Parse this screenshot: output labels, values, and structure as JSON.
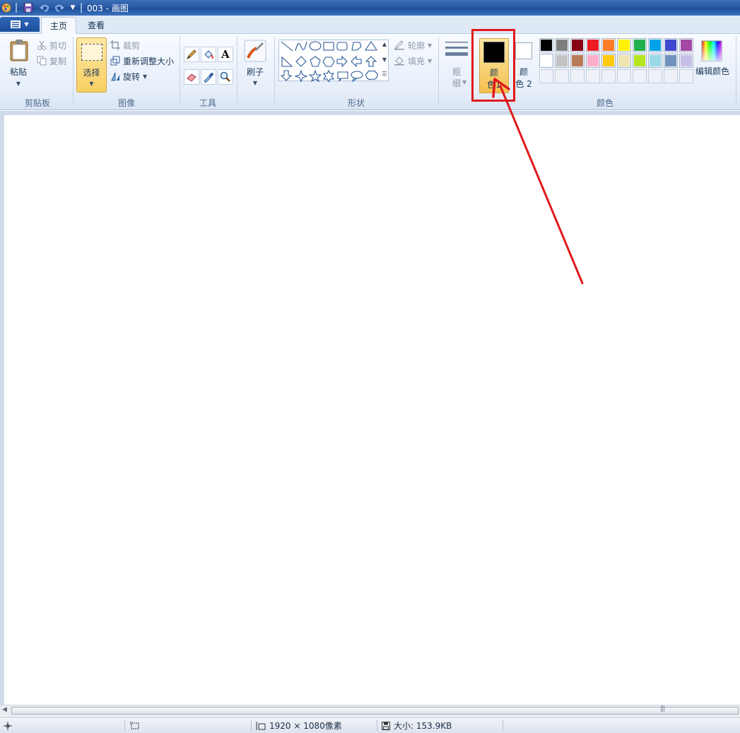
{
  "window": {
    "title": "003 - 画图"
  },
  "tabs": {
    "home": "主页",
    "view": "查看"
  },
  "clipboard": {
    "paste": "粘贴",
    "cut": "剪切",
    "copy": "复制",
    "group": "剪贴板"
  },
  "image": {
    "select": "选择",
    "crop": "裁剪",
    "resize": "重新调整大小",
    "rotate": "旋转",
    "group": "图像"
  },
  "tools": {
    "group": "工具"
  },
  "brushes": {
    "label": "刷子"
  },
  "shapes": {
    "outline": "轮廓",
    "fill": "填充",
    "group": "形状"
  },
  "size": {
    "label_line1": "粗",
    "label_line2": "细"
  },
  "colors": {
    "color1_line1": "颜",
    "color1_line2": "色1",
    "color2_line1": "颜",
    "color2_line2": "色 2",
    "edit": "编辑颜色",
    "group": "颜色",
    "palette_row1": [
      "#000000",
      "#7f7f7f",
      "#880015",
      "#ed1c24",
      "#ff7f27",
      "#fff200",
      "#22b14c",
      "#00a2e8",
      "#3f48cc",
      "#a349a4"
    ],
    "palette_row2": [
      "#ffffff",
      "#c3c3c3",
      "#b97a57",
      "#ffaec9",
      "#ffc90e",
      "#efe4b0",
      "#b5e61d",
      "#99d9ea",
      "#7092be",
      "#c8bfe7"
    ],
    "current_color1": "#000000",
    "current_color2": "#ffffff",
    "highlight": "#e0191c"
  },
  "status": {
    "dimensions": "1920 × 1080像素",
    "size": "大小: 153.9KB"
  }
}
